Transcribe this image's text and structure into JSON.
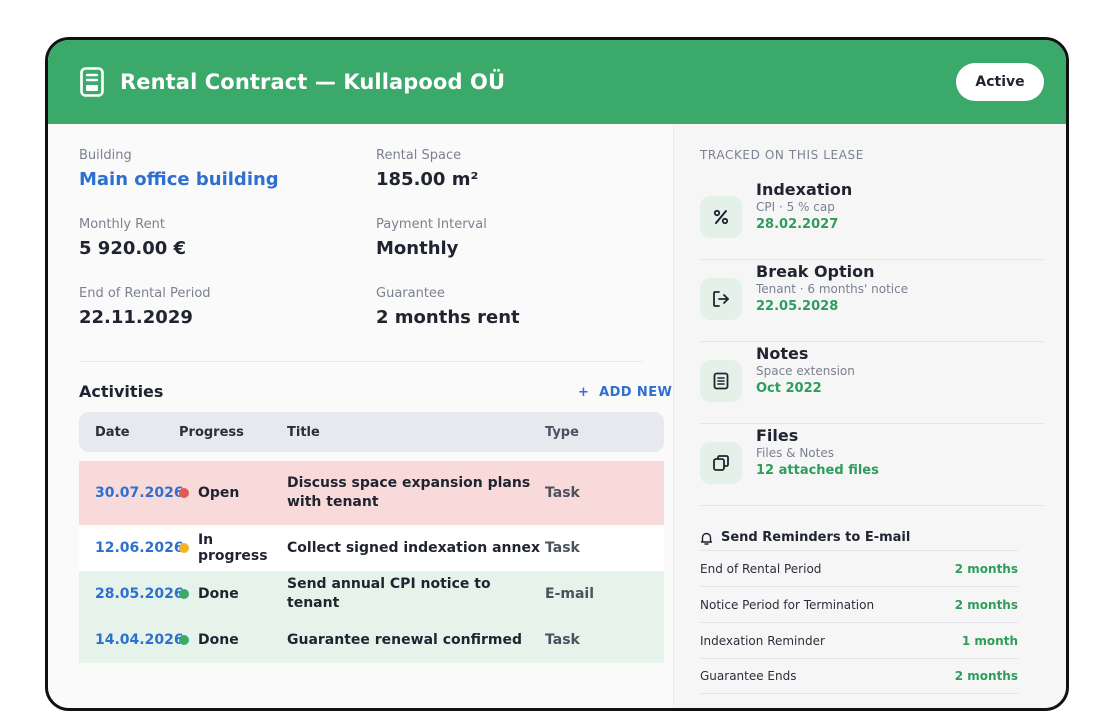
{
  "contract": {
    "title": "Rental Contract — Kullapood OÜ",
    "status": "Active"
  },
  "details": {
    "building_label": "Building",
    "building_value": "Main office building",
    "space_label": "Rental Space",
    "space_value": "185.00 m²",
    "rent_label": "Monthly Rent",
    "rent_value": "5 920.00 €",
    "interval_label": "Payment Interval",
    "interval_value": "Monthly",
    "end_label": "End of Rental Period",
    "end_value": "22.11.2029",
    "guarantee_label": "Guarantee",
    "guarantee_value": "2 months rent"
  },
  "activities": {
    "title": "Activities",
    "add_label": "ADD NEW",
    "columns": [
      "Date",
      "Progress",
      "Title",
      "Type"
    ],
    "rows": [
      {
        "date": "30.07.2026",
        "progress": "Open",
        "title": "Discuss space expansion plans with tenant",
        "type": "Task",
        "bg": "#f9dada",
        "dot": "#e05a5a"
      },
      {
        "date": "12.06.2026",
        "progress": "In progress",
        "title": "Collect signed indexation annex",
        "type": "Task",
        "bg": "#ffffff",
        "dot": "#f0b429"
      },
      {
        "date": "28.05.2026",
        "progress": "Done",
        "title": "Send annual CPI notice to tenant",
        "type": "E-mail",
        "bg": "#e6f3ea",
        "dot": "#3aa96a"
      },
      {
        "date": "14.04.2026",
        "progress": "Done",
        "title": "Guarantee renewal confirmed",
        "type": "Task",
        "bg": "#e6f3ea",
        "dot": "#3aa96a"
      }
    ]
  },
  "tracked": {
    "title": "TRACKED ON THIS LEASE",
    "items": [
      {
        "name": "Indexation",
        "sub": "CPI · 5 % cap",
        "value": "28.02.2027",
        "icon": "percent-icon"
      },
      {
        "name": "Break Option",
        "sub": "Tenant · 6 months' notice",
        "value": "22.05.2028",
        "icon": "exit-icon"
      },
      {
        "name": "Notes",
        "sub": "Space extension",
        "value": "Oct 2022",
        "icon": "notes-icon"
      },
      {
        "name": "Files",
        "sub": "Files & Notes",
        "value": "12 attached files",
        "icon": "files-icon"
      }
    ]
  },
  "reminders": {
    "title": "Send Reminders to E-mail",
    "rows": [
      {
        "label": "End of Rental Period",
        "value": "2 months"
      },
      {
        "label": "Notice Period for Termination",
        "value": "2 months"
      },
      {
        "label": "Indexation Reminder",
        "value": "1 month"
      },
      {
        "label": "Guarantee Ends",
        "value": "2 months"
      }
    ]
  },
  "colors": {
    "brand": "#3aa96a",
    "link": "#2f6fcf",
    "value_green": "#2e9d5c"
  }
}
